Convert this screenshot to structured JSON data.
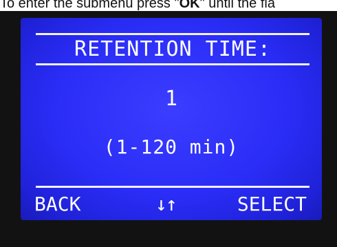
{
  "caption": {
    "prefix": "To enter the submenu press \"",
    "key": "OK",
    "suffix": "\" until the fla"
  },
  "display": {
    "title": "RETENTION TIME:",
    "value": "1",
    "range": "(1-120 min)",
    "softkeys": {
      "back": "BACK",
      "arrows": "↓↑",
      "select": "SELECT"
    }
  },
  "colors": {
    "screen": "#2a2df6",
    "text": "#ffffff",
    "bezel": "#121212"
  }
}
